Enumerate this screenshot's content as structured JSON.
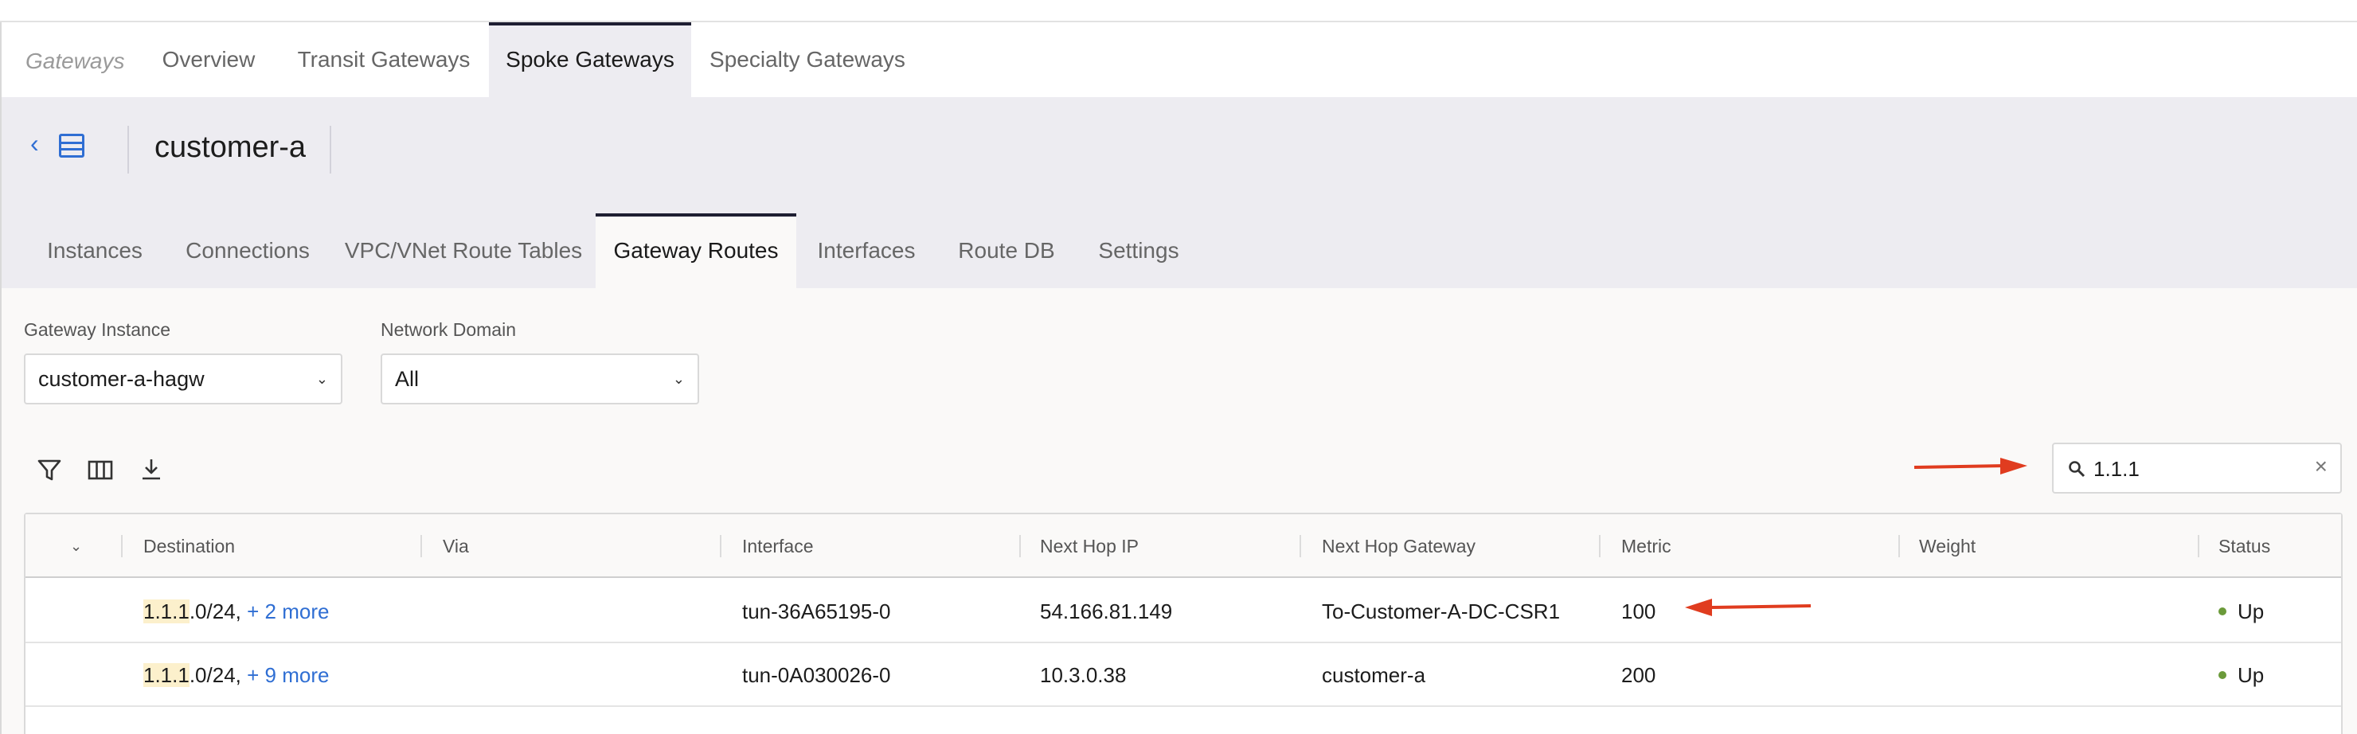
{
  "top_nav": {
    "breadcrumb": "Gateways",
    "tabs": [
      "Overview",
      "Transit Gateways",
      "Spoke Gateways",
      "Specialty Gateways"
    ],
    "active_tab": "Spoke Gateways"
  },
  "header": {
    "title": "customer-a"
  },
  "sub_tabs": {
    "tabs": [
      "Instances",
      "Connections",
      "VPC/VNet Route Tables",
      "Gateway Routes",
      "Interfaces",
      "Route DB",
      "Settings"
    ],
    "active_tab": "Gateway Routes"
  },
  "filters": {
    "gateway_instance_label": "Gateway Instance",
    "gateway_instance_value": "customer-a-hagw",
    "network_domain_label": "Network Domain",
    "network_domain_value": "All"
  },
  "search": {
    "value": "1.1.1"
  },
  "table": {
    "columns": [
      "Destination",
      "Via",
      "Interface",
      "Next Hop IP",
      "Next Hop Gateway",
      "Metric",
      "Weight",
      "Status"
    ],
    "rows": [
      {
        "destination_match": "1.1.1",
        "destination_rest": ".0/24, ",
        "destination_more": "+ 2 more",
        "via": "",
        "interface": "tun-36A65195-0",
        "next_hop_ip": "54.166.81.149",
        "next_hop_gateway": "To-Customer-A-DC-CSR1",
        "metric": "100",
        "weight": "",
        "status": "Up"
      },
      {
        "destination_match": "1.1.1",
        "destination_rest": ".0/24, ",
        "destination_more": "+ 9 more",
        "via": "",
        "interface": "tun-0A030026-0",
        "next_hop_ip": "10.3.0.38",
        "next_hop_gateway": "customer-a",
        "metric": "200",
        "weight": "",
        "status": "Up"
      }
    ]
  },
  "colors": {
    "accent_blue": "#2f6ed3",
    "annotation_red": "#e03c1f",
    "status_up": "#6b9a3a",
    "highlight": "#fcf0cc"
  }
}
